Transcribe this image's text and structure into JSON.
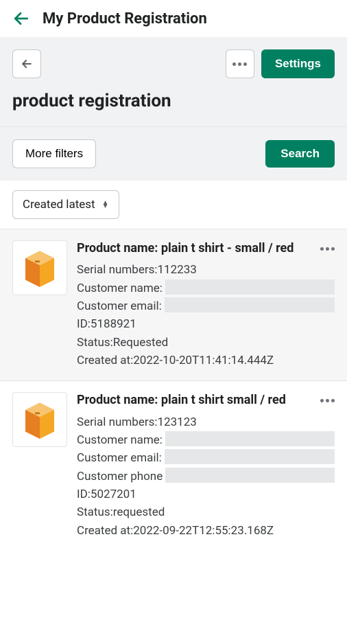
{
  "topbar": {
    "title": "My Product Registration"
  },
  "toolbar": {
    "settings_label": "Settings"
  },
  "page": {
    "title": "product registration"
  },
  "filters": {
    "more_filters_label": "More filters",
    "search_label": "Search"
  },
  "sort": {
    "selected": "Created latest"
  },
  "cards": [
    {
      "title": "Product name: plain t shirt - small / red",
      "serial_label": "Serial numbers: ",
      "serial_value": "112233",
      "cust_name_label": "Customer name:",
      "cust_email_label": "Customer email:",
      "id_label": "ID: ",
      "id_value": "5188921",
      "status_label": "Status: ",
      "status_value": "Requested",
      "created_label": "Created at: ",
      "created_value": "2022-10-20T11:41:14.444Z"
    },
    {
      "title": "Product name: plain t shirt small / red",
      "serial_label": "Serial numbers: ",
      "serial_value": "123123",
      "cust_name_label": "Customer name:",
      "cust_email_label": "Customer email:",
      "cust_phone_label": "Customer phone",
      "id_label": "ID: ",
      "id_value": "5027201",
      "status_label": "Status: ",
      "status_value": "requested",
      "created_label": "Created at: ",
      "created_value": "2022-09-22T12:55:23.168Z"
    }
  ]
}
